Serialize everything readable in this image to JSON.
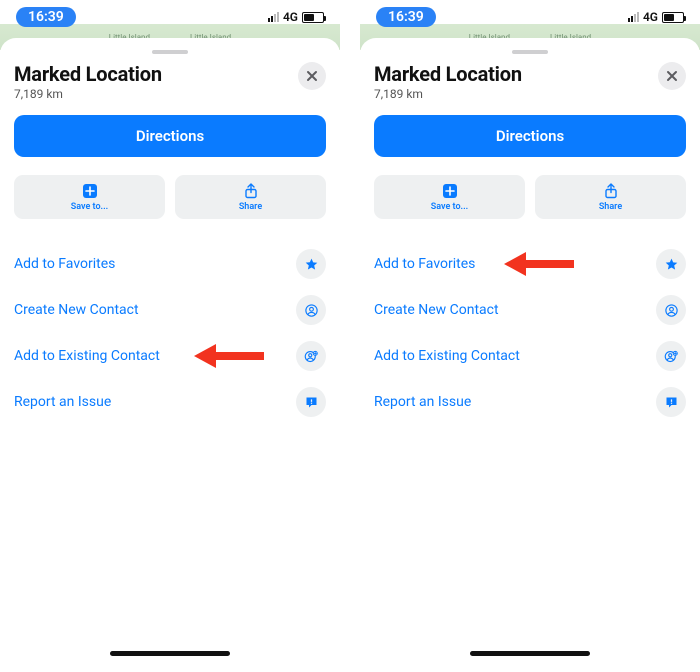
{
  "statusbar": {
    "time": "16:39",
    "network": "4G"
  },
  "map": {
    "label_left": "Little Island",
    "label_right": "Little Island"
  },
  "sheet": {
    "title": "Marked Location",
    "subtitle": "7,189 km",
    "directions_label": "Directions",
    "save_label": "Save to...",
    "share_label": "Share",
    "rows": {
      "favorites": "Add to Favorites",
      "newcontact": "Create New Contact",
      "addcontact": "Add to Existing Contact",
      "report": "Report an Issue"
    }
  },
  "arrows": {
    "left_target": "addcontact",
    "right_target": "favorites"
  }
}
